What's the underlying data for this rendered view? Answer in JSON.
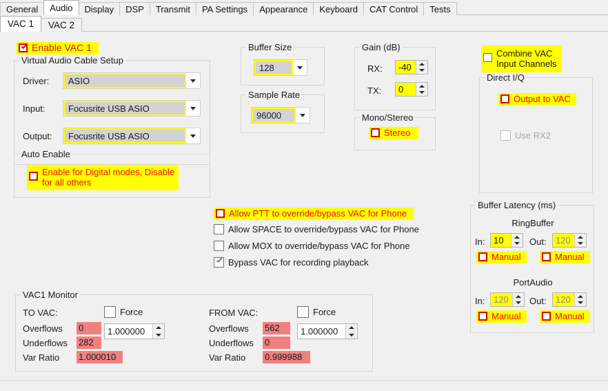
{
  "main_tabs": [
    {
      "label": "General",
      "selected": false
    },
    {
      "label": "Audio",
      "selected": true
    },
    {
      "label": "Display",
      "selected": false
    },
    {
      "label": "DSP",
      "selected": false
    },
    {
      "label": "Transmit",
      "selected": false
    },
    {
      "label": "PA Settings",
      "selected": false
    },
    {
      "label": "Appearance",
      "selected": false
    },
    {
      "label": "Keyboard",
      "selected": false
    },
    {
      "label": "CAT Control",
      "selected": false
    },
    {
      "label": "Tests",
      "selected": false
    }
  ],
  "sub_tabs": [
    {
      "label": "VAC 1",
      "selected": true
    },
    {
      "label": "VAC 2",
      "selected": false
    }
  ],
  "enable_vac": {
    "label": "Enable VAC 1",
    "checked": true
  },
  "vac_setup": {
    "caption": "Virtual Audio Cable Setup",
    "driver_label": "Driver:",
    "driver_value": "ASIO",
    "input_label": "Input:",
    "input_value": "Focusrite USB ASIO",
    "output_label": "Output:",
    "output_value": "Focusrite USB ASIO"
  },
  "auto_enable": {
    "caption": "Auto Enable",
    "checkbox_line1": "Enable for Digital modes, Disable",
    "checkbox_line2": "for all others",
    "checked": false
  },
  "buffer_size": {
    "caption": "Buffer Size",
    "value": "128"
  },
  "sample_rate": {
    "caption": "Sample Rate",
    "value": "96000"
  },
  "gain": {
    "caption": "Gain (dB)",
    "rx_label": "RX:",
    "rx_value": "-40",
    "tx_label": "TX:",
    "tx_value": "0"
  },
  "mono_stereo": {
    "caption": "Mono/Stereo",
    "stereo_label": "Stereo",
    "stereo_checked": false
  },
  "combine_vac": {
    "line1": "Combine VAC",
    "line2": "Input Channels",
    "checked": false
  },
  "direct_iq": {
    "caption": "Direct I/Q",
    "output_label": "Output to VAC",
    "output_checked": false,
    "rx2_label": "Use RX2",
    "rx2_checked": false,
    "rx2_disabled": true
  },
  "override_options": [
    {
      "label": "Allow PTT to override/bypass VAC for Phone",
      "checked": false,
      "highlight": true
    },
    {
      "label": "Allow SPACE to override/bypass VAC for Phone",
      "checked": false,
      "highlight": false
    },
    {
      "label": "Allow MOX to override/bypass VAC for Phone",
      "checked": false,
      "highlight": false
    },
    {
      "label": "Bypass VAC for recording playback",
      "checked": true,
      "highlight": false
    }
  ],
  "buffer_latency": {
    "caption": "Buffer Latency (ms)",
    "ring_title": "RingBuffer",
    "port_title": "PortAudio",
    "in_label": "In:",
    "out_label": "Out:",
    "manual_label": "Manual",
    "ring_in": "10",
    "ring_out": "120",
    "port_in": "120",
    "port_out": "120",
    "ring_in_disabled": false,
    "ring_out_disabled": true,
    "port_in_disabled": true,
    "port_out_disabled": true,
    "ring_in_manual": false,
    "ring_out_manual": false,
    "port_in_manual": false,
    "port_out_manual": false
  },
  "monitor": {
    "caption": "VAC1 Monitor",
    "to_vac": {
      "title": "TO VAC:",
      "force_label": "Force",
      "force_checked": false,
      "overflows_label": "Overflows",
      "overflows_value": "0",
      "underflows_label": "Underflows",
      "underflows_value": "282",
      "var_ratio_label": "Var Ratio",
      "var_ratio_value": "1.000010",
      "spin_value": "1.000000"
    },
    "from_vac": {
      "title": "FROM VAC:",
      "force_label": "Force",
      "force_checked": false,
      "overflows_label": "Overflows",
      "overflows_value": "562",
      "underflows_label": "Underflows",
      "underflows_value": "0",
      "var_ratio_label": "Var Ratio",
      "var_ratio_value": "0.999988",
      "spin_value": "1.000000"
    }
  },
  "colors": {
    "highlight": "#ffff00",
    "alert": "#f08080",
    "red_text": "#e81010",
    "background": "#f0f0f0"
  }
}
